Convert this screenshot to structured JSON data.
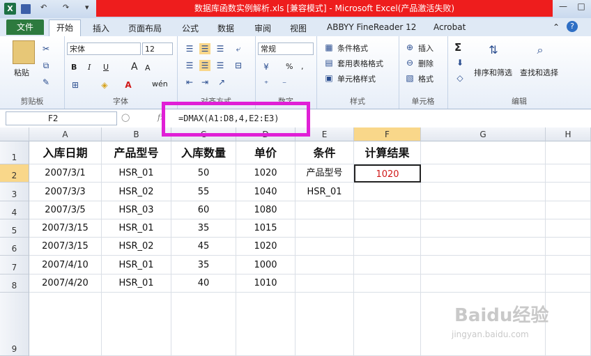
{
  "window": {
    "title": "数据库函数实例解析.xls  [兼容模式]  -  Microsoft Excel(产品激活失败)",
    "quick_access": {
      "undo": "↶",
      "redo": "↷",
      "more": "▾"
    },
    "controls": {
      "minimize": "—",
      "maximize": "□",
      "close": "✕"
    }
  },
  "tabs": [
    {
      "label": "文件"
    },
    {
      "label": "开始"
    },
    {
      "label": "插入"
    },
    {
      "label": "页面布局"
    },
    {
      "label": "公式"
    },
    {
      "label": "数据"
    },
    {
      "label": "审阅"
    },
    {
      "label": "视图"
    },
    {
      "label": "ABBYY FineReader 12"
    },
    {
      "label": "Acrobat"
    }
  ],
  "ribbon": {
    "clipboard": {
      "label": "剪贴板",
      "paste": "粘贴"
    },
    "font": {
      "label": "字体",
      "name": "宋体",
      "size": "12",
      "bold": "B",
      "italic": "I",
      "underline": "U",
      "grow": "A",
      "shrink": "A",
      "wen": "wén"
    },
    "alignment": {
      "label": "对齐方式"
    },
    "number": {
      "label": "数字",
      "format": "常规",
      "percent": "%",
      "comma": ","
    },
    "styles": {
      "label": "样式",
      "conditional": "条件格式",
      "table": "套用表格格式",
      "cell_styles": "单元格样式"
    },
    "cells": {
      "label": "单元格",
      "insert": "插入",
      "delete": "删除",
      "format": "格式"
    },
    "editing": {
      "label": "编辑",
      "sum": "Σ",
      "sort": "排序和筛选",
      "find": "查找和选择"
    }
  },
  "formula_bar": {
    "name_box": "F2",
    "formula": "=DMAX(A1:D8,4,E2:E3)"
  },
  "columns": [
    "A",
    "B",
    "C",
    "D",
    "E",
    "F",
    "G",
    "H"
  ],
  "rows": [
    "1",
    "2",
    "3",
    "4",
    "5",
    "6",
    "7",
    "8",
    "9"
  ],
  "cells": [
    [
      "入库日期",
      "产品型号",
      "入库数量",
      "单价",
      "条件",
      "计算结果",
      "",
      ""
    ],
    [
      "2007/3/1",
      "HSR_01",
      "50",
      "1020",
      "产品型号",
      "1020",
      "",
      ""
    ],
    [
      "2007/3/3",
      "HSR_02",
      "55",
      "1040",
      "HSR_01",
      "",
      "",
      ""
    ],
    [
      "2007/3/5",
      "HSR_03",
      "60",
      "1080",
      "",
      "",
      "",
      ""
    ],
    [
      "2007/3/15",
      "HSR_01",
      "35",
      "1015",
      "",
      "",
      "",
      ""
    ],
    [
      "2007/3/15",
      "HSR_02",
      "45",
      "1020",
      "",
      "",
      "",
      ""
    ],
    [
      "2007/4/10",
      "HSR_01",
      "35",
      "1000",
      "",
      "",
      "",
      ""
    ],
    [
      "2007/4/20",
      "HSR_01",
      "40",
      "1010",
      "",
      "",
      "",
      ""
    ],
    [
      "",
      "",
      "",
      "",
      "",
      "",
      "",
      ""
    ]
  ],
  "watermark": {
    "brand": "Baidu经验",
    "url": "jingyan.baidu.com"
  }
}
